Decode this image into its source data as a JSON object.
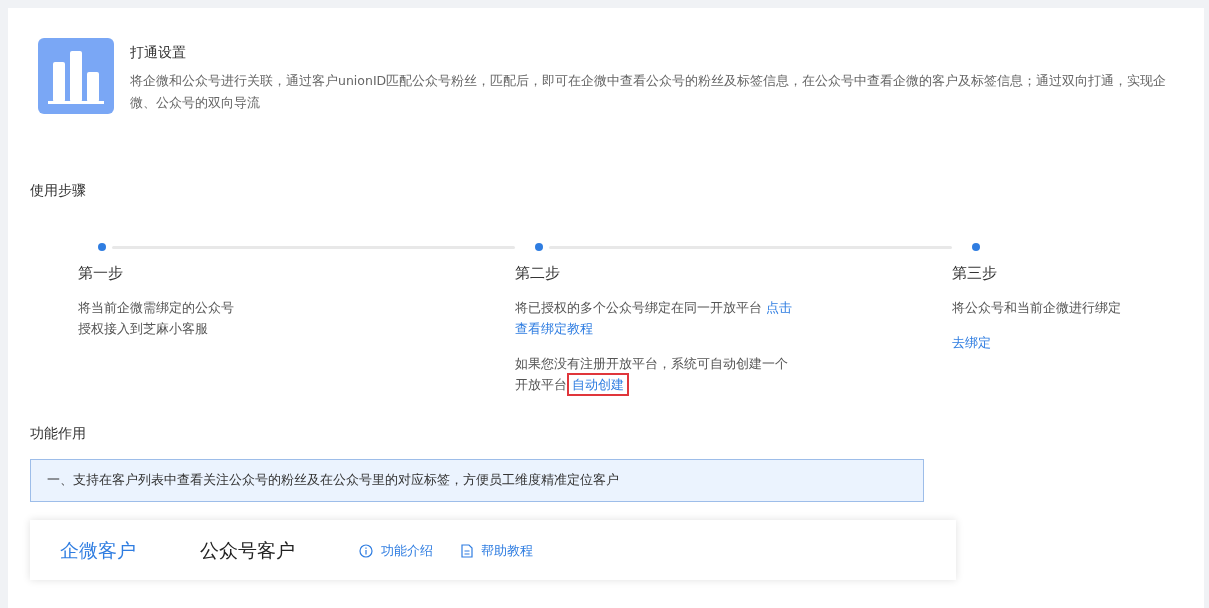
{
  "header": {
    "title": "打通设置",
    "description": "将企微和公众号进行关联，通过客户unionID匹配公众号粉丝，匹配后，即可在企微中查看公众号的粉丝及标签信息，在公众号中查看企微的客户及标签信息；通过双向打通，实现企微、公众号的双向导流"
  },
  "steps_section": {
    "title": "使用步骤",
    "steps": [
      {
        "title": "第一步",
        "paragraphs": [
          [
            {
              "kind": "text",
              "text": "将当前企微需绑定的公众号"
            },
            {
              "kind": "break"
            },
            {
              "kind": "text",
              "text": "授权接入到芝麻小客服"
            }
          ]
        ]
      },
      {
        "title": "第二步",
        "paragraphs": [
          [
            {
              "kind": "text",
              "text": "将已授权的多个公众号绑定在同一开放平台 "
            },
            {
              "kind": "link",
              "text": "点击",
              "highlighted": false
            },
            {
              "kind": "break"
            },
            {
              "kind": "link",
              "text": "查看绑定教程",
              "highlighted": false
            }
          ],
          [
            {
              "kind": "text",
              "text": "如果您没有注册开放平台，系统可自动创建一个"
            },
            {
              "kind": "break"
            },
            {
              "kind": "text",
              "text": "开放平台"
            },
            {
              "kind": "link",
              "text": "自动创建",
              "highlighted": true
            }
          ]
        ]
      },
      {
        "title": "第三步",
        "paragraphs": [
          [
            {
              "kind": "text",
              "text": "将公众号和当前企微进行绑定"
            }
          ],
          [
            {
              "kind": "link",
              "text": "去绑定",
              "highlighted": false
            }
          ]
        ]
      }
    ]
  },
  "features_section": {
    "title": "功能作用",
    "notice": "一、支持在客户列表中查看关注公众号的粉丝及在公众号里的对应标签，方便员工维度精准定位客户",
    "tabs": [
      {
        "label": "企微客户",
        "selected": true
      },
      {
        "label": "公众号客户",
        "selected": false
      }
    ],
    "links": [
      {
        "kind": "info",
        "label": "功能介绍"
      },
      {
        "kind": "doc",
        "label": "帮助教程"
      }
    ]
  }
}
